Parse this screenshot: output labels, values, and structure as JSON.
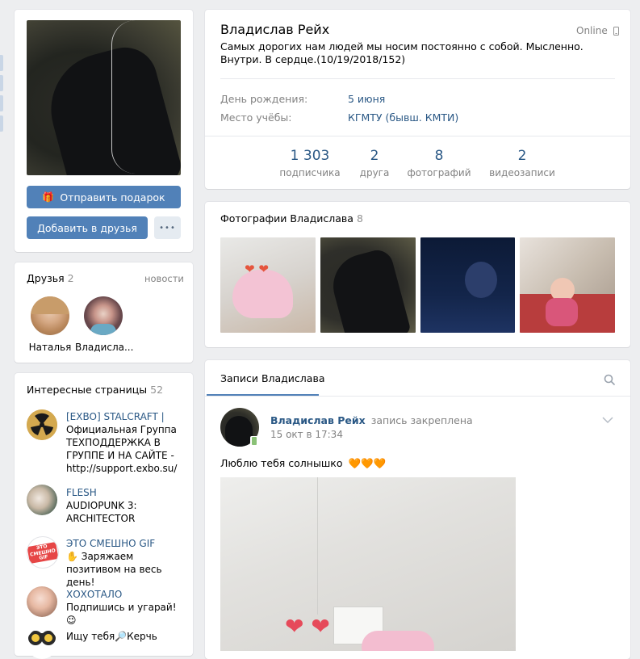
{
  "profile": {
    "name": "Владислав Рейх",
    "status": "Самых дорогих нам людей мы носим постоянно с собой. Мысленно. Внутри. В сердце.(10/19/2018/152)",
    "online": "Online",
    "info": [
      {
        "label": "День рождения:",
        "value": "5 июня"
      },
      {
        "label": "Место учёбы:",
        "value": "КГМТУ (бывш. КМТИ)"
      }
    ],
    "stats": [
      {
        "num": "1 303",
        "label": "подписчика"
      },
      {
        "num": "2",
        "label": "друга"
      },
      {
        "num": "8",
        "label": "фотографий"
      },
      {
        "num": "2",
        "label": "видеозаписи"
      }
    ]
  },
  "actions": {
    "gift": "Отправить подарок",
    "add_friend": "Добавить в друзья",
    "more": "•••"
  },
  "friends": {
    "title": "Друзья",
    "count": "2",
    "news_link": "новости",
    "items": [
      {
        "name": "Наталья"
      },
      {
        "name": "Владисла..."
      }
    ]
  },
  "pages": {
    "title": "Интересные страницы",
    "count": "52",
    "items": [
      {
        "name": "[EXBO] STALCRAFT |",
        "desc": "Официальная Группа ТЕХПОДДЕРЖКА В ГРУППЕ И НА САЙТЕ - http://support.exbo.su/",
        "name_line2": ""
      },
      {
        "name": "FLESH",
        "desc": "AUDIOPUNK 3: ARCHITECTOR"
      },
      {
        "name": "ЭТО СМЕШНО GIF",
        "desc": "✋ Заряжаем позитивом на весь день!",
        "icon_text": "ЭТО СМЕШНО GIF"
      },
      {
        "name": "ХОХОТАЛО",
        "desc": "Подпишись и угарай!😉"
      },
      {
        "name": "Ищу тебя🔎Керчь",
        "desc": ""
      }
    ]
  },
  "photos": {
    "title": "Фотографии Владислава",
    "count": "8"
  },
  "wall": {
    "tab": "Записи Владислава",
    "post": {
      "author": "Владислав Рейх",
      "pinned": "запись закреплена",
      "date": "15 окт в 17:34",
      "text": "Люблю тебя солнышко",
      "hearts": "🧡🧡🧡"
    }
  },
  "colors": {
    "accent": "#5181b8",
    "link": "#2a5885",
    "background": "#edeef0"
  }
}
